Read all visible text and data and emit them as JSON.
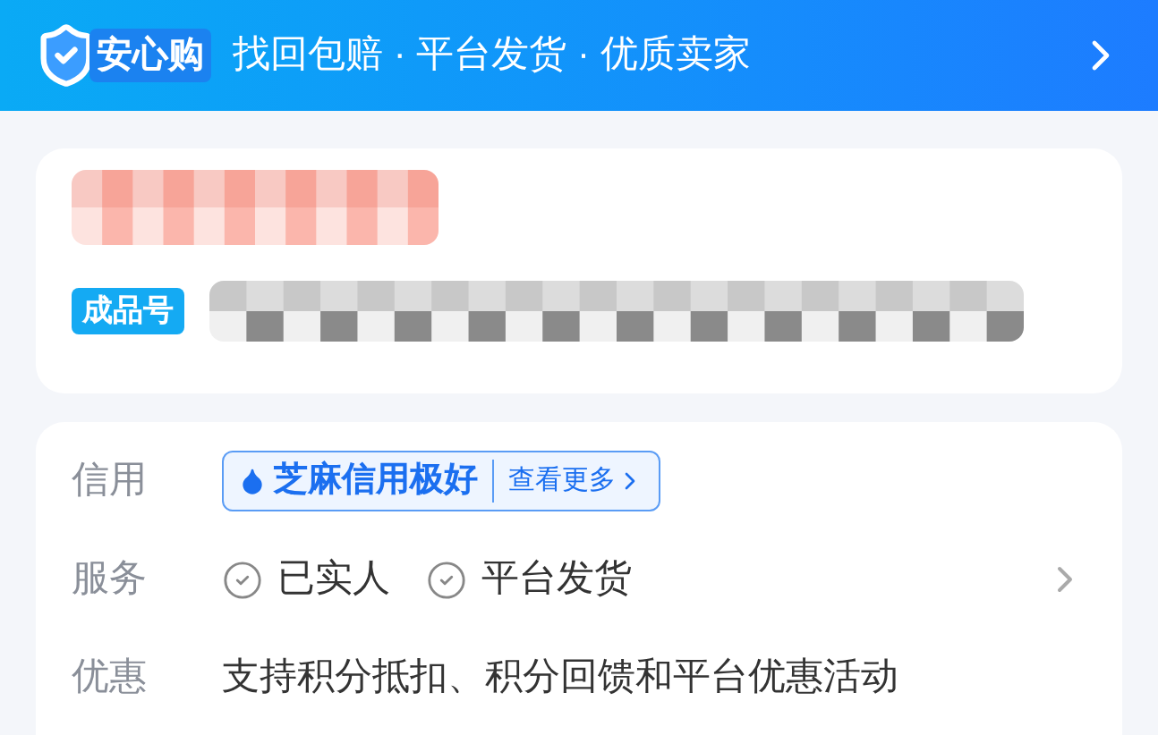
{
  "banner": {
    "badge": "安心购",
    "text": "找回包赔 · 平台发货 · 优质卖家"
  },
  "product": {
    "tag": "成品号"
  },
  "details": [
    {
      "kind": "credit",
      "label": "信用",
      "credit": "芝麻信用极好",
      "more": "查看更多"
    },
    {
      "kind": "service",
      "label": "服务",
      "items": [
        "已实人",
        "平台发货"
      ]
    },
    {
      "kind": "text",
      "label": "优惠",
      "text": "支持积分抵扣、积分回馈和平台优惠活动"
    }
  ]
}
